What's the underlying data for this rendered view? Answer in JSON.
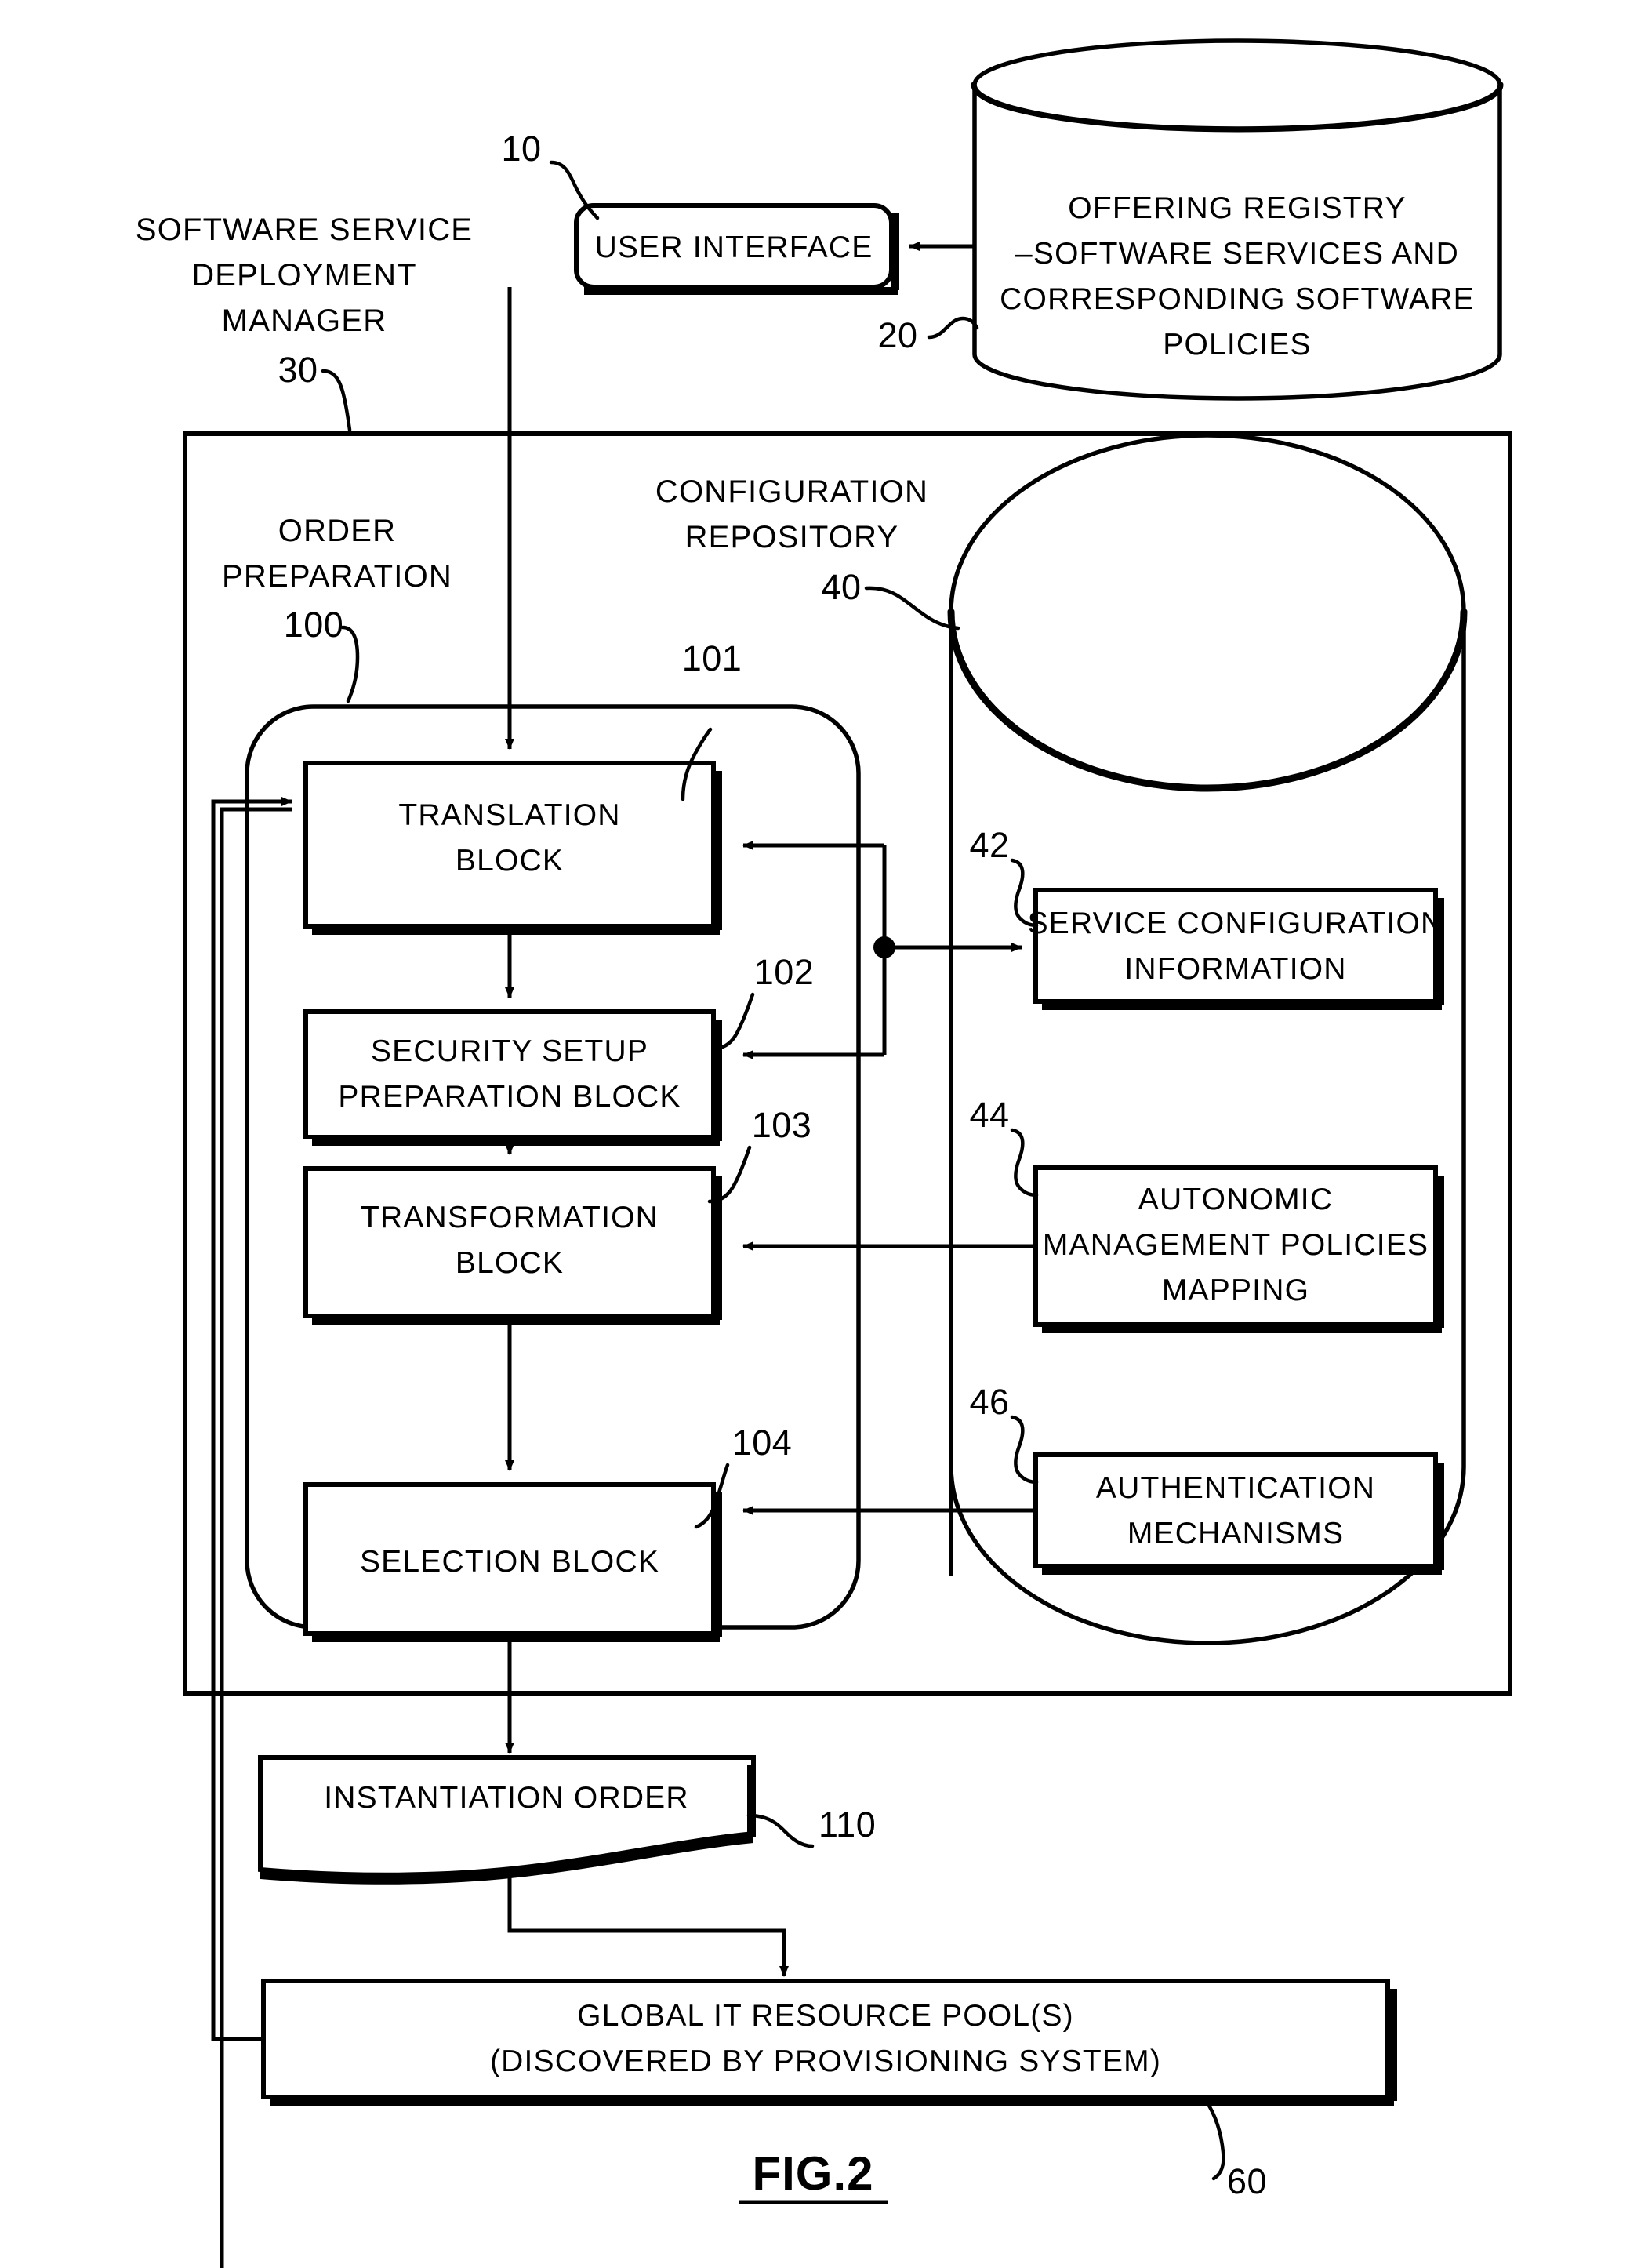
{
  "figure": {
    "label": "FIG.2",
    "title": "Software service deployment manager block diagram"
  },
  "nodes": {
    "user_interface": {
      "label": "USER INTERFACE",
      "ref": "10"
    },
    "offering_registry": {
      "lines": [
        "OFFERING REGISTRY",
        "–SOFTWARE SERVICES AND",
        "CORRESPONDING SOFTWARE",
        "POLICIES"
      ],
      "ref": "20"
    },
    "deployment_manager": {
      "lines": [
        "SOFTWARE SERVICE",
        "DEPLOYMENT",
        "MANAGER"
      ],
      "ref": "30"
    },
    "order_preparation": {
      "lines": [
        "ORDER",
        "PREPARATION"
      ],
      "ref": "100"
    },
    "configuration_repository": {
      "lines": [
        "CONFIGURATION",
        "REPOSITORY"
      ],
      "ref": "40"
    },
    "translation_block": {
      "lines": [
        "TRANSLATION",
        "BLOCK"
      ],
      "ref": "101"
    },
    "security_setup_block": {
      "lines": [
        "SECURITY SETUP",
        "PREPARATION BLOCK"
      ],
      "ref": "102"
    },
    "transformation_block": {
      "lines": [
        "TRANSFORMATION",
        "BLOCK"
      ],
      "ref": "103"
    },
    "selection_block": {
      "lines": [
        "SELECTION BLOCK"
      ],
      "ref": "104"
    },
    "service_configuration_information": {
      "lines": [
        "SERVICE CONFIGURATION",
        "INFORMATION"
      ],
      "ref": "42"
    },
    "autonomic_management_policies_mapping": {
      "lines": [
        "AUTONOMIC",
        "MANAGEMENT POLICIES",
        "MAPPING"
      ],
      "ref": "44"
    },
    "authentication_mechanisms": {
      "lines": [
        "AUTHENTICATION",
        "MECHANISMS"
      ],
      "ref": "46"
    },
    "instantiation_order": {
      "lines": [
        "INSTANTIATION ORDER"
      ],
      "ref": "110"
    },
    "global_it_resource_pool": {
      "lines": [
        "GLOBAL IT RESOURCE POOL(S)",
        "(DISCOVERED BY PROVISIONING SYSTEM)"
      ],
      "ref": "60"
    }
  },
  "colors": {
    "ink": "#000000",
    "paper": "#ffffff"
  }
}
